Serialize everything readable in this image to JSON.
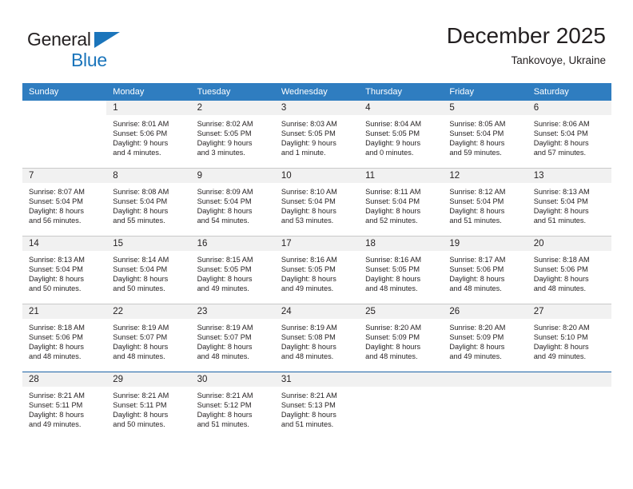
{
  "brand": {
    "name_top": "General",
    "name_bottom": "Blue",
    "accent_color": "#1b75bb",
    "triangle_icon": "triangle-icon"
  },
  "header": {
    "title": "December 2025",
    "subtitle": "Tankovoye, Ukraine"
  },
  "calendar": {
    "header_bg": "#2f7dc0",
    "daynum_bg": "#f1f1f1",
    "weekdays": [
      "Sunday",
      "Monday",
      "Tuesday",
      "Wednesday",
      "Thursday",
      "Friday",
      "Saturday"
    ],
    "weeks": [
      [
        {
          "day": "",
          "blank": true,
          "lines": []
        },
        {
          "day": "1",
          "lines": [
            "Sunrise: 8:01 AM",
            "Sunset: 5:06 PM",
            "Daylight: 9 hours",
            "and 4 minutes."
          ]
        },
        {
          "day": "2",
          "lines": [
            "Sunrise: 8:02 AM",
            "Sunset: 5:05 PM",
            "Daylight: 9 hours",
            "and 3 minutes."
          ]
        },
        {
          "day": "3",
          "lines": [
            "Sunrise: 8:03 AM",
            "Sunset: 5:05 PM",
            "Daylight: 9 hours",
            "and 1 minute."
          ]
        },
        {
          "day": "4",
          "lines": [
            "Sunrise: 8:04 AM",
            "Sunset: 5:05 PM",
            "Daylight: 9 hours",
            "and 0 minutes."
          ]
        },
        {
          "day": "5",
          "lines": [
            "Sunrise: 8:05 AM",
            "Sunset: 5:04 PM",
            "Daylight: 8 hours",
            "and 59 minutes."
          ]
        },
        {
          "day": "6",
          "lines": [
            "Sunrise: 8:06 AM",
            "Sunset: 5:04 PM",
            "Daylight: 8 hours",
            "and 57 minutes."
          ]
        }
      ],
      [
        {
          "day": "7",
          "lines": [
            "Sunrise: 8:07 AM",
            "Sunset: 5:04 PM",
            "Daylight: 8 hours",
            "and 56 minutes."
          ]
        },
        {
          "day": "8",
          "lines": [
            "Sunrise: 8:08 AM",
            "Sunset: 5:04 PM",
            "Daylight: 8 hours",
            "and 55 minutes."
          ]
        },
        {
          "day": "9",
          "lines": [
            "Sunrise: 8:09 AM",
            "Sunset: 5:04 PM",
            "Daylight: 8 hours",
            "and 54 minutes."
          ]
        },
        {
          "day": "10",
          "lines": [
            "Sunrise: 8:10 AM",
            "Sunset: 5:04 PM",
            "Daylight: 8 hours",
            "and 53 minutes."
          ]
        },
        {
          "day": "11",
          "lines": [
            "Sunrise: 8:11 AM",
            "Sunset: 5:04 PM",
            "Daylight: 8 hours",
            "and 52 minutes."
          ]
        },
        {
          "day": "12",
          "lines": [
            "Sunrise: 8:12 AM",
            "Sunset: 5:04 PM",
            "Daylight: 8 hours",
            "and 51 minutes."
          ]
        },
        {
          "day": "13",
          "lines": [
            "Sunrise: 8:13 AM",
            "Sunset: 5:04 PM",
            "Daylight: 8 hours",
            "and 51 minutes."
          ]
        }
      ],
      [
        {
          "day": "14",
          "lines": [
            "Sunrise: 8:13 AM",
            "Sunset: 5:04 PM",
            "Daylight: 8 hours",
            "and 50 minutes."
          ]
        },
        {
          "day": "15",
          "lines": [
            "Sunrise: 8:14 AM",
            "Sunset: 5:04 PM",
            "Daylight: 8 hours",
            "and 50 minutes."
          ]
        },
        {
          "day": "16",
          "lines": [
            "Sunrise: 8:15 AM",
            "Sunset: 5:05 PM",
            "Daylight: 8 hours",
            "and 49 minutes."
          ]
        },
        {
          "day": "17",
          "lines": [
            "Sunrise: 8:16 AM",
            "Sunset: 5:05 PM",
            "Daylight: 8 hours",
            "and 49 minutes."
          ]
        },
        {
          "day": "18",
          "lines": [
            "Sunrise: 8:16 AM",
            "Sunset: 5:05 PM",
            "Daylight: 8 hours",
            "and 48 minutes."
          ]
        },
        {
          "day": "19",
          "lines": [
            "Sunrise: 8:17 AM",
            "Sunset: 5:06 PM",
            "Daylight: 8 hours",
            "and 48 minutes."
          ]
        },
        {
          "day": "20",
          "lines": [
            "Sunrise: 8:18 AM",
            "Sunset: 5:06 PM",
            "Daylight: 8 hours",
            "and 48 minutes."
          ]
        }
      ],
      [
        {
          "day": "21",
          "lines": [
            "Sunrise: 8:18 AM",
            "Sunset: 5:06 PM",
            "Daylight: 8 hours",
            "and 48 minutes."
          ]
        },
        {
          "day": "22",
          "lines": [
            "Sunrise: 8:19 AM",
            "Sunset: 5:07 PM",
            "Daylight: 8 hours",
            "and 48 minutes."
          ]
        },
        {
          "day": "23",
          "lines": [
            "Sunrise: 8:19 AM",
            "Sunset: 5:07 PM",
            "Daylight: 8 hours",
            "and 48 minutes."
          ]
        },
        {
          "day": "24",
          "lines": [
            "Sunrise: 8:19 AM",
            "Sunset: 5:08 PM",
            "Daylight: 8 hours",
            "and 48 minutes."
          ]
        },
        {
          "day": "25",
          "lines": [
            "Sunrise: 8:20 AM",
            "Sunset: 5:09 PM",
            "Daylight: 8 hours",
            "and 48 minutes."
          ]
        },
        {
          "day": "26",
          "lines": [
            "Sunrise: 8:20 AM",
            "Sunset: 5:09 PM",
            "Daylight: 8 hours",
            "and 49 minutes."
          ]
        },
        {
          "day": "27",
          "lines": [
            "Sunrise: 8:20 AM",
            "Sunset: 5:10 PM",
            "Daylight: 8 hours",
            "and 49 minutes."
          ]
        }
      ],
      [
        {
          "day": "28",
          "lines": [
            "Sunrise: 8:21 AM",
            "Sunset: 5:11 PM",
            "Daylight: 8 hours",
            "and 49 minutes."
          ]
        },
        {
          "day": "29",
          "lines": [
            "Sunrise: 8:21 AM",
            "Sunset: 5:11 PM",
            "Daylight: 8 hours",
            "and 50 minutes."
          ]
        },
        {
          "day": "30",
          "lines": [
            "Sunrise: 8:21 AM",
            "Sunset: 5:12 PM",
            "Daylight: 8 hours",
            "and 51 minutes."
          ]
        },
        {
          "day": "31",
          "lines": [
            "Sunrise: 8:21 AM",
            "Sunset: 5:13 PM",
            "Daylight: 8 hours",
            "and 51 minutes."
          ]
        },
        {
          "day": "",
          "empty": true,
          "lines": []
        },
        {
          "day": "",
          "empty": true,
          "lines": []
        },
        {
          "day": "",
          "empty": true,
          "lines": []
        }
      ]
    ]
  }
}
